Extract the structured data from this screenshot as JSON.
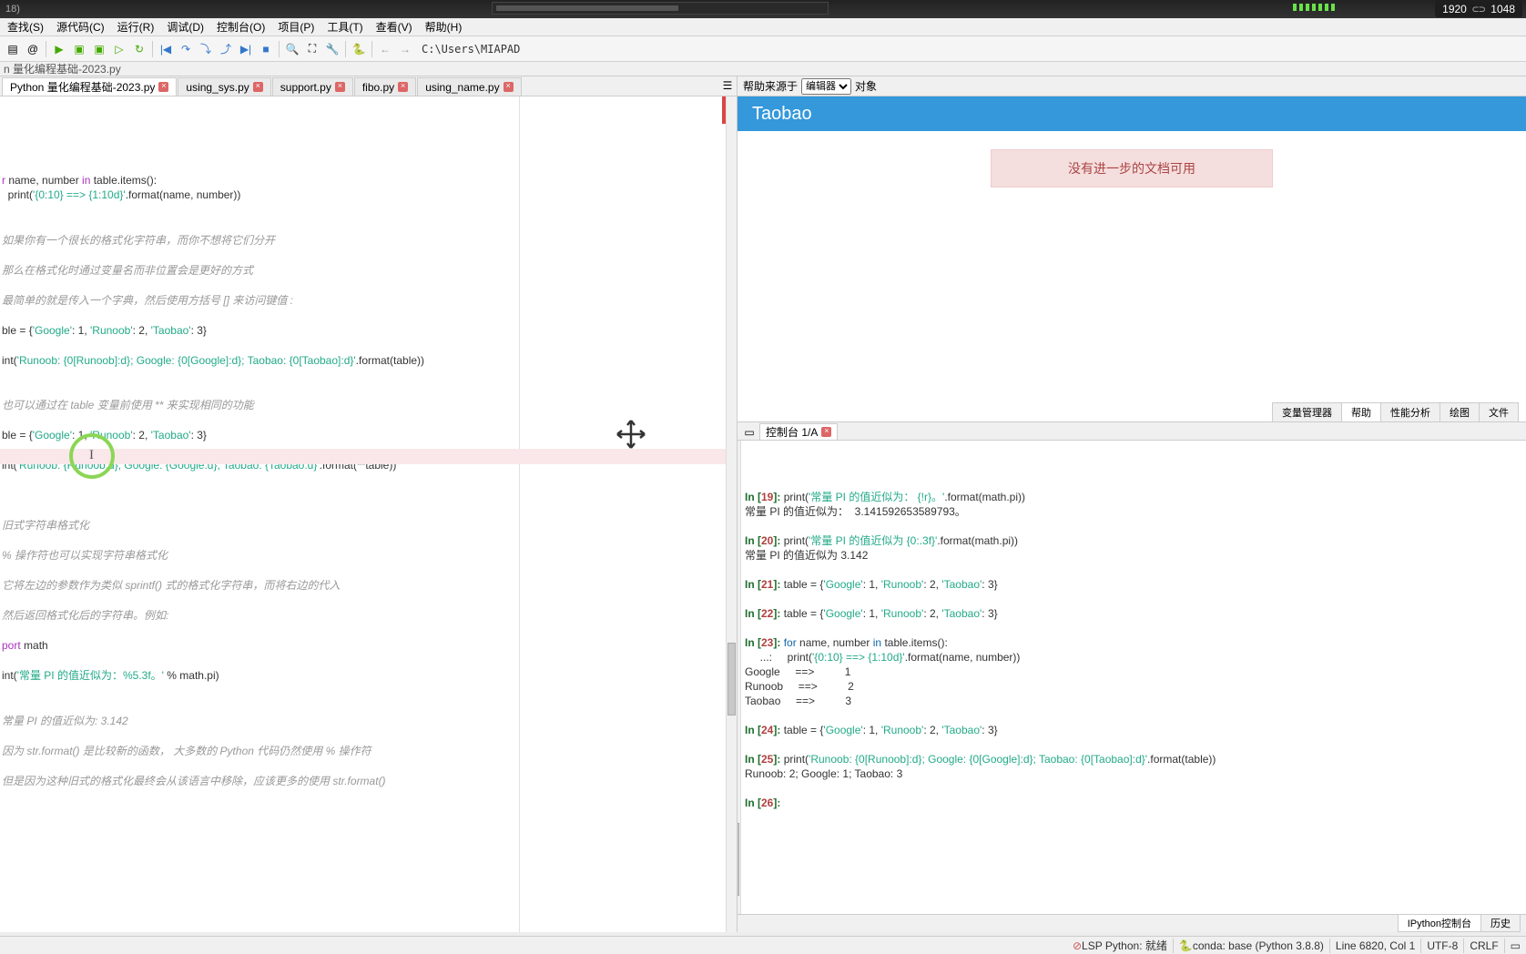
{
  "title_suffix": "18)",
  "resolution": {
    "w": "1920",
    "h": "1048",
    "link_glyph": "⊂⊃"
  },
  "menus": [
    "查找(S)",
    "源代码(C)",
    "运行(R)",
    "调试(D)",
    "控制台(O)",
    "项目(P)",
    "工具(T)",
    "查看(V)",
    "帮助(H)"
  ],
  "path": "C:\\Users\\MIAPAD",
  "editor_header": "n 量化编程基础-2023.py",
  "tabs": [
    {
      "label": "Python 量化编程基础-2023.py",
      "active": true,
      "closeable": true
    },
    {
      "label": "using_sys.py",
      "active": false,
      "closeable": true
    },
    {
      "label": "support.py",
      "active": false,
      "closeable": true
    },
    {
      "label": "fibo.py",
      "active": false,
      "closeable": true
    },
    {
      "label": "using_name.py",
      "active": false,
      "closeable": true
    }
  ],
  "code_lines_html": "<span class='k'>r</span> name, number <span class='k'>in</span> table.items():\n  <span class='n'>print</span>(<span class='s'>'{0:10} ==> {1:10d}'</span>.format(name, number))\n\n\n<span class='c'>如果你有一个很长的格式化字符串，而你不想将它们分开</span>\n\n<span class='c'>那么在格式化时通过变量名而非位置会是更好的方式</span>\n\n<span class='c'>最简单的就是传入一个字典，然后使用方括号 [] 来访问键值 :</span>\n\nble = {<span class='s'>'Google'</span>: 1, <span class='s'>'Runoob'</span>: 2, <span class='s'>'Taobao'</span>: 3}\n\nint(<span class='s'>'Runoob: {0[Runoob]:d}; Google: {0[Google]:d}; Taobao: {0[Taobao]:d}'</span>.format(table))\n\n\n<span class='c'>也可以通过在 table 变量前使用 ** 来实现相同的功能</span>\n\nble = {<span class='s'>'Google'</span>: 1, <span class='s'>'Runoob'</span>: 2, <span class='s'>'Taobao'</span>: 3}\n\nint(<span class='s'>'Runoob: {Runoob:d}; Google: {Google:d}; Taobao: {Taobao:d}'</span>.format(**table))\n\n\n\n<span class='c'>旧式字符串格式化</span>\n\n<span class='c'>% 操作符也可以实现字符串格式化</span>\n\n<span class='c'>它将左边的参数作为类似 sprintf() 式的格式化字符串，而将右边的代入</span>\n\n<span class='c'>然后返回格式化后的字符串。例如:</span>\n\n<span class='k'>port</span> math\n\nint(<span class='s'>'常量 PI 的值近似为：%5.3f。'</span> % math.pi)\n\n\n<span class='c'>常量 PI 的值近似为: 3.142</span>\n\n<span class='c'>因为 str.format() 是比较新的函数， 大多数的 Python 代码仍然使用 % 操作符</span>\n\n<span class='c'>但是因为这种旧式的格式化最终会从该语言中移除，应该更多的使用 str.format()</span>\n",
  "help": {
    "source_label": "帮助来源于",
    "source_options": [
      "编辑器"
    ],
    "object_label": "对象",
    "title": "Taobao",
    "no_doc": "没有进一步的文档可用",
    "tabs": [
      "变量管理器",
      "帮助",
      "性能分析",
      "绘图",
      "文件"
    ]
  },
  "console": {
    "tab_label": "控制台 1/A",
    "bottom_tabs": [
      "IPython控制台",
      "历史"
    ],
    "lines_html": "<span class='pr'>In [</span><span class='nm'>19</span><span class='pr'>]:</span> print(<span class='cs'>'常量 PI 的值近似为： {!r}。'</span>.format(math.pi))\n常量 PI 的值近似为：  3.141592653589793。\n\n<span class='pr'>In [</span><span class='nm'>20</span><span class='pr'>]:</span> print(<span class='cs'>'常量 PI 的值近似为 {0:.3f}'</span>.format(math.pi))\n常量 PI 的值近似为 3.142\n\n<span class='pr'>In [</span><span class='nm'>21</span><span class='pr'>]:</span> table = {<span class='cs'>'Google'</span>: 1, <span class='cs'>'Runoob'</span>: 2, <span class='cs'>'Taobao'</span>: 3}\n\n<span class='pr'>In [</span><span class='nm'>22</span><span class='pr'>]:</span> table = {<span class='cs'>'Google'</span>: 1, <span class='cs'>'Runoob'</span>: 2, <span class='cs'>'Taobao'</span>: 3}\n\n<span class='pr'>In [</span><span class='nm'>23</span><span class='pr'>]:</span> <span class='ck'>for</span> name, number <span class='ck'>in</span> table.items():\n     ...:     print(<span class='cs'>'{0:10} ==> {1:10d}'</span>.format(name, number))\nGoogle     ==>          1\nRunoob     ==>          2\nTaobao     ==>          3\n\n<span class='pr'>In [</span><span class='nm'>24</span><span class='pr'>]:</span> table = {<span class='cs'>'Google'</span>: 1, <span class='cs'>'Runoob'</span>: 2, <span class='cs'>'Taobao'</span>: 3}\n\n<span class='pr'>In [</span><span class='nm'>25</span><span class='pr'>]:</span> print(<span class='cs'>'Runoob: {0[Runoob]:d}; Google: {0[Google]:d}; Taobao: {0[Taobao]:d}'</span>.format(table))\nRunoob: 2; Google: 1; Taobao: 3\n\n<span class='pr'>In [</span><span class='nm'>26</span><span class='pr'>]:</span> "
  },
  "status": {
    "lsp": "LSP Python: 就绪",
    "conda": "conda: base (Python 3.8.8)",
    "pos": "Line 6820, Col 1",
    "enc": "UTF-8",
    "eol": "CRLF",
    "mem_icon": "▭"
  },
  "icons": {
    "new": "▤",
    "save": "💾",
    "saveall": "▦",
    "at": "@",
    "run": "▶",
    "runcell": "▣",
    "runline": "▷",
    "debug": "🐞",
    "reload": "↻",
    "stepback": "|◀",
    "stepover": "↷",
    "stepin": "⤵",
    "stepout": "⤴",
    "stepfwd": "▶|",
    "stop": "■",
    "breakpoint": "●",
    "search": "🔍",
    "fullscreen": "⛶",
    "settings": "🔧",
    "python": "🐍",
    "back": "←",
    "fwd": "→",
    "tablist": "☰",
    "consolebar": "▭"
  }
}
